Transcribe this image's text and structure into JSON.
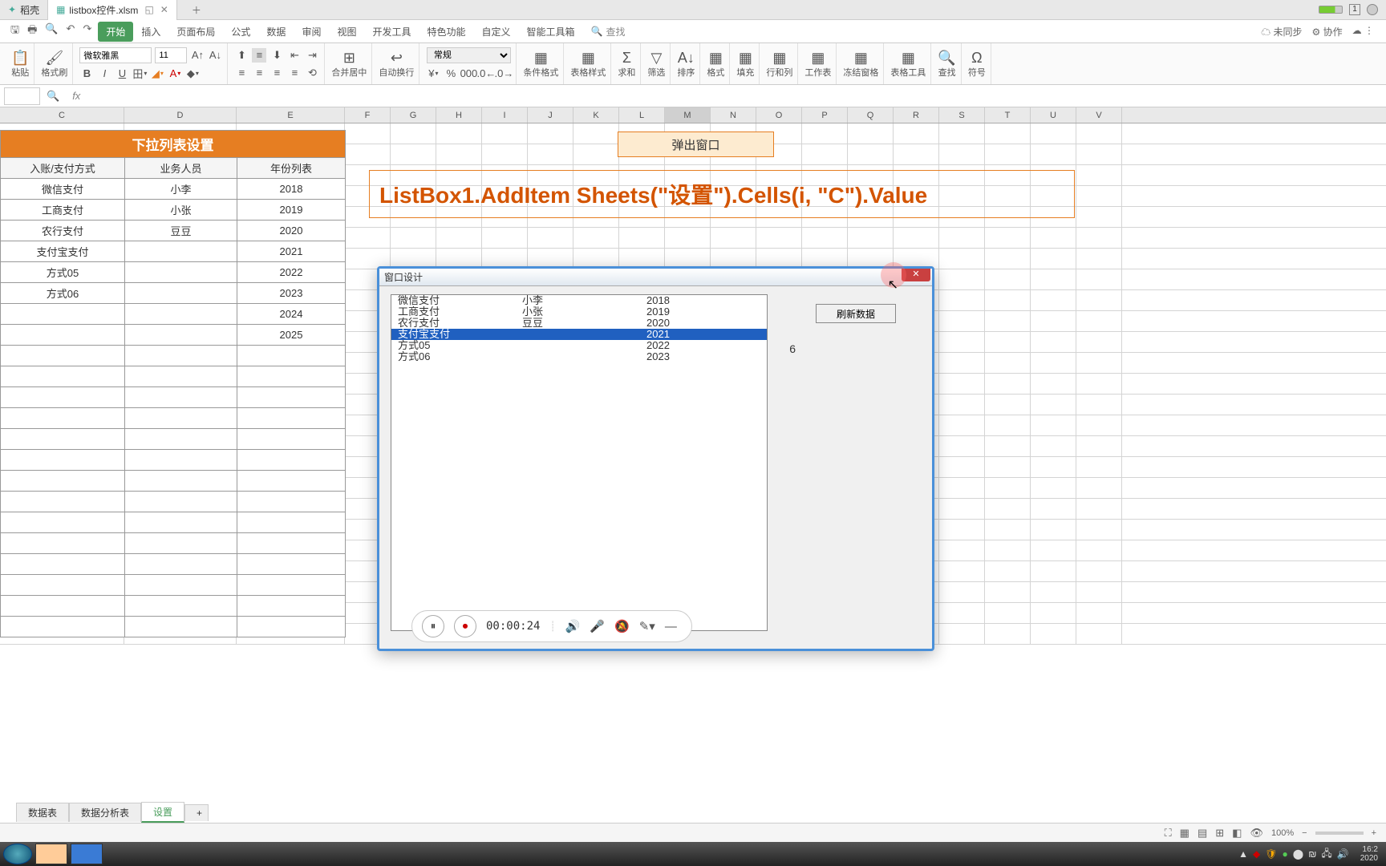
{
  "tabs": {
    "shell": "稻壳",
    "file": "listbox控件.xlsm"
  },
  "title_right": {
    "mode": "1"
  },
  "ribbon": {
    "tabs": [
      "开始",
      "插入",
      "页面布局",
      "公式",
      "数据",
      "审阅",
      "视图",
      "开发工具",
      "特色功能",
      "自定义",
      "智能工具箱"
    ],
    "search_label": "查找",
    "right": {
      "sync": "未同步",
      "collab": "协作"
    },
    "font": {
      "name": "微软雅黑",
      "size": "11"
    },
    "groups": {
      "paste": "粘贴",
      "brush": "格式刷",
      "merge": "合并居中",
      "wrap": "自动换行",
      "numfmt": "常规",
      "cond": "条件格式",
      "tstyle": "表格样式",
      "sum": "求和",
      "filter": "筛选",
      "sort": "排序",
      "format": "格式",
      "fill": "填充",
      "rowcol": "行和列",
      "sheet": "工作表",
      "freeze": "冻结窗格",
      "ttool": "表格工具",
      "find": "查找",
      "symbol": "符号"
    }
  },
  "table": {
    "title": "下拉列表设置",
    "headers": [
      "入账/支付方式",
      "业务人员",
      "年份列表"
    ],
    "rows": [
      [
        "微信支付",
        "小李",
        "2018"
      ],
      [
        "工商支付",
        "小张",
        "2019"
      ],
      [
        "农行支付",
        "豆豆",
        "2020"
      ],
      [
        "支付宝支付",
        "",
        "2021"
      ],
      [
        "方式05",
        "",
        "2022"
      ],
      [
        "方式06",
        "",
        "2023"
      ],
      [
        "",
        "",
        "2024"
      ],
      [
        "",
        "",
        "2025"
      ]
    ]
  },
  "popup_btn": "弹出窗口",
  "code_text": "ListBox1.AddItem Sheets(\"设置\").Cells(i, \"C\").Value",
  "userform": {
    "title": "窗口设计",
    "refresh": "刷新数据",
    "label6": "6",
    "rows": [
      [
        "微信支付",
        "小李",
        "2018"
      ],
      [
        "工商支付",
        "小张",
        "2019"
      ],
      [
        "农行支付",
        "豆豆",
        "2020"
      ],
      [
        "支付宝支付",
        "",
        "2021"
      ],
      [
        "方式05",
        "",
        "2022"
      ],
      [
        "方式06",
        "",
        "2023"
      ]
    ],
    "selected_index": 3
  },
  "recorder": {
    "time": "00:00:24"
  },
  "sheet_tabs": [
    "数据表",
    "数据分析表",
    "设置"
  ],
  "status": {
    "zoom": "100%"
  },
  "columns": [
    "C",
    "D",
    "E",
    "F",
    "G",
    "H",
    "I",
    "J",
    "K",
    "L",
    "M",
    "N",
    "O",
    "P",
    "Q",
    "R",
    "S",
    "T",
    "U",
    "V"
  ],
  "taskbar": {
    "time": "16:2",
    "date": "2020"
  }
}
